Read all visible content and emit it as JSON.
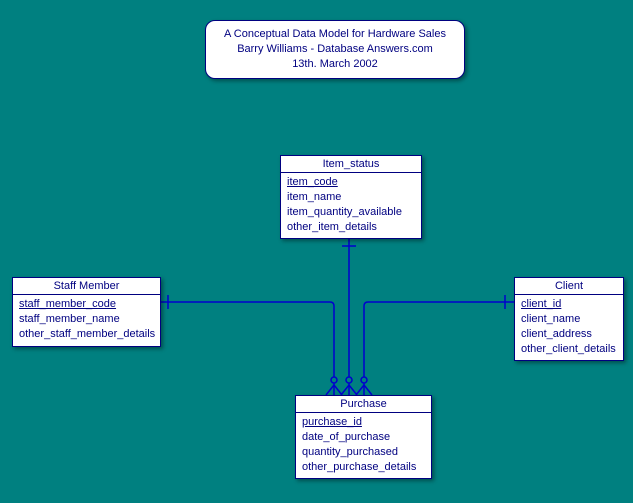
{
  "title": {
    "line1": "A Conceptual Data Model for Hardware Sales",
    "line2": "Barry Williams - Database Answers.com",
    "line3": "13th. March 2002"
  },
  "entities": {
    "item_status": {
      "name": "Item_status",
      "pk": "item_code",
      "a1": "item_name",
      "a2": "item_quantity_available",
      "a3": "other_item_details"
    },
    "staff_member": {
      "name": "Staff Member",
      "pk": "staff_member_code",
      "a1": "staff_member_name",
      "a2": "other_staff_member_details"
    },
    "client": {
      "name": "Client",
      "pk": "client_id",
      "a1": "client_name",
      "a2": "client_address",
      "a3": "other_client_details"
    },
    "purchase": {
      "name": "Purchase",
      "pk": "purchase_id",
      "a1": "date_of_purchase",
      "a2": "quantity_purchased",
      "a3": "other_purchase_details"
    }
  }
}
